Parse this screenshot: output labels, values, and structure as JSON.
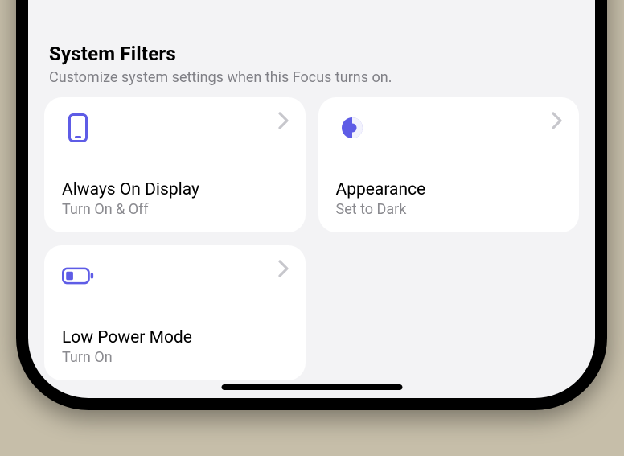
{
  "section": {
    "title": "System Filters",
    "subtitle": "Customize system settings when this Focus turns on."
  },
  "cards": {
    "aod": {
      "title": "Always On Display",
      "detail": "Turn On & Off"
    },
    "appearance": {
      "title": "Appearance",
      "detail": "Set to Dark"
    },
    "lowpower": {
      "title": "Low Power Mode",
      "detail": "Turn On"
    }
  }
}
